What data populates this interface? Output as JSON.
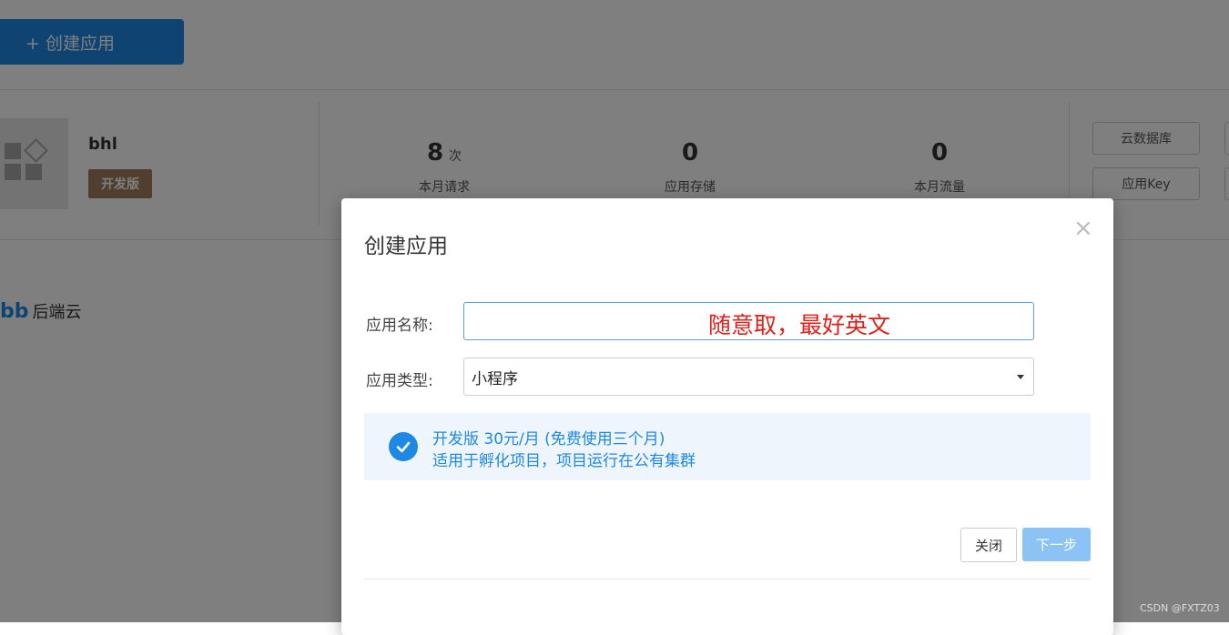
{
  "page": {
    "create_button": "+ 创建应用",
    "app": {
      "name": "bhl",
      "badge": "开发版"
    },
    "stats": [
      {
        "value": "8",
        "unit": "次",
        "label": "本月请求"
      },
      {
        "value": "0",
        "unit": "",
        "label": "应用存储"
      },
      {
        "value": "0",
        "unit": "",
        "label": "本月流量"
      }
    ],
    "side_buttons": [
      "云数据库",
      "应用Key"
    ],
    "brand": {
      "logo": "bb",
      "text": "后端云"
    }
  },
  "modal": {
    "title": "创建应用",
    "close_glyph": "×",
    "name_label": "应用名称:",
    "name_value": "",
    "annotation": "随意取，最好英文",
    "type_label": "应用类型:",
    "type_value": "小程序",
    "plan": {
      "line1": "开发版 30元/月 (免费使用三个月)",
      "line2": "适用于孵化项目，项目运行在公有集群"
    },
    "close_button": "关闭",
    "next_button": "下一步"
  },
  "watermark": "CSDN @FXTZ03",
  "colors": {
    "primary": "#1e88e5",
    "badge": "#a07d5e",
    "annotation": "#e0201a",
    "next_disabled": "#8cc3f5"
  },
  "icons": [
    "app-placeholder-icon",
    "close-icon",
    "chevron-down-icon",
    "check-icon"
  ]
}
